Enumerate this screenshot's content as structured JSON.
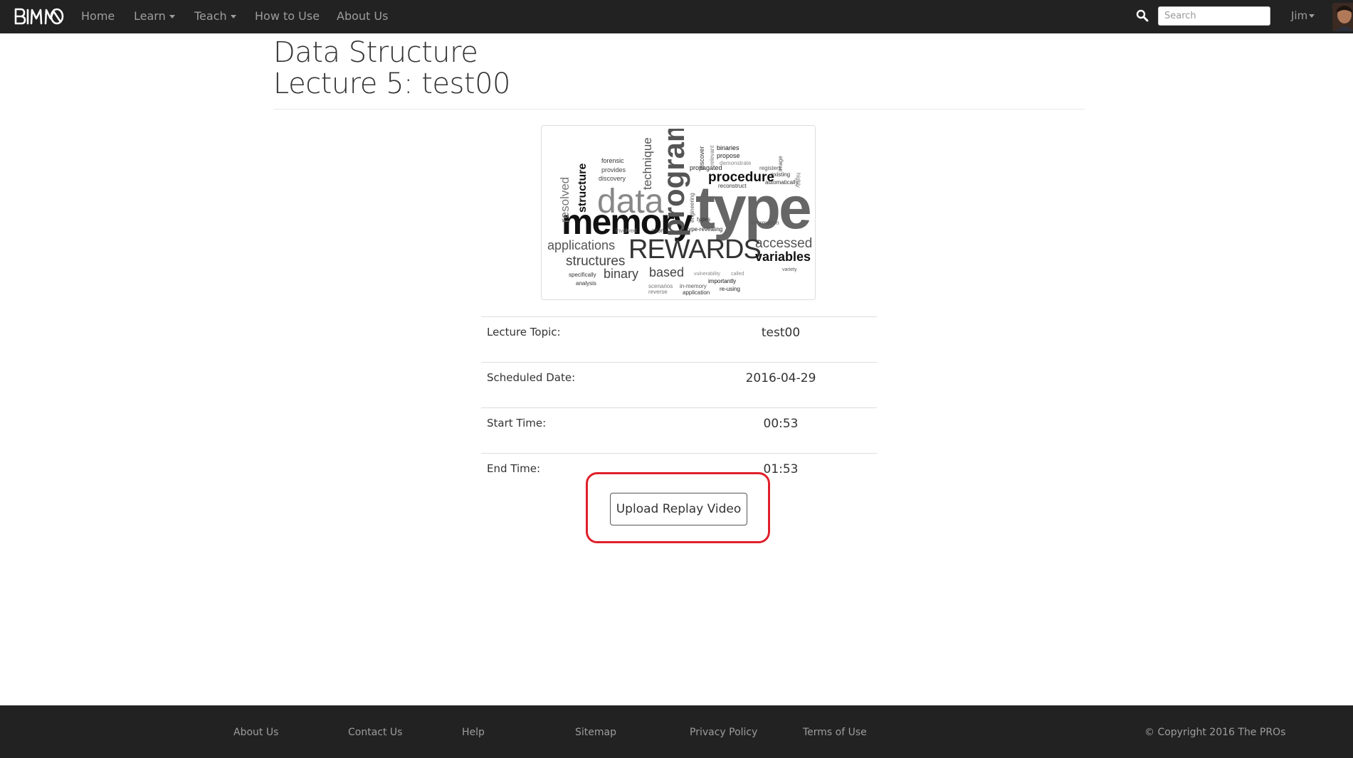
{
  "navbar": {
    "brand": "BIMO",
    "items": [
      {
        "label": "Home"
      },
      {
        "label": "Learn"
      },
      {
        "label": "Teach"
      },
      {
        "label": "How to Use"
      },
      {
        "label": "About Us"
      }
    ],
    "search_placeholder": "Search",
    "user": "Jim"
  },
  "header": {
    "course": "Data Structure",
    "lecture": "Lecture 5: test00"
  },
  "word_cloud": {
    "words": [
      "type",
      "memory",
      "data",
      "program",
      "REWARDS",
      "structures",
      "procedure",
      "variables",
      "accessed",
      "binary",
      "based",
      "applications",
      "structure",
      "resolved",
      "technique",
      "forensic",
      "provides",
      "discovery",
      "binaries",
      "propose",
      "demonstrate",
      "propagated",
      "registers",
      "reconstruct",
      "existing",
      "automatically",
      "information",
      "type-revealing",
      "efforts",
      "involved",
      "types",
      "specifically",
      "analysis",
      "scenarios",
      "reverse",
      "in-memory",
      "application",
      "importantly",
      "re-using",
      "vulnerability",
      "called",
      "variety",
      "engineering",
      "highly",
      "image",
      "discover",
      "relevant"
    ]
  },
  "details": [
    {
      "label": "Lecture Topic:",
      "value": "test00"
    },
    {
      "label": "Scheduled Date:",
      "value": "2016-04-29"
    },
    {
      "label": "Start Time:",
      "value": "00:53"
    },
    {
      "label": "End Time:",
      "value": "01:53"
    }
  ],
  "upload_button": "Upload Replay Video",
  "footer": {
    "links": [
      "About Us",
      "Contact Us",
      "Help",
      "Sitemap",
      "Privacy Policy",
      "Terms of Use"
    ],
    "copyright": "© Copyright 2016 The PROs"
  },
  "colors": {
    "navbar_bg": "#222222",
    "nav_text": "#9d9d9d",
    "highlight": "#e0202a"
  }
}
